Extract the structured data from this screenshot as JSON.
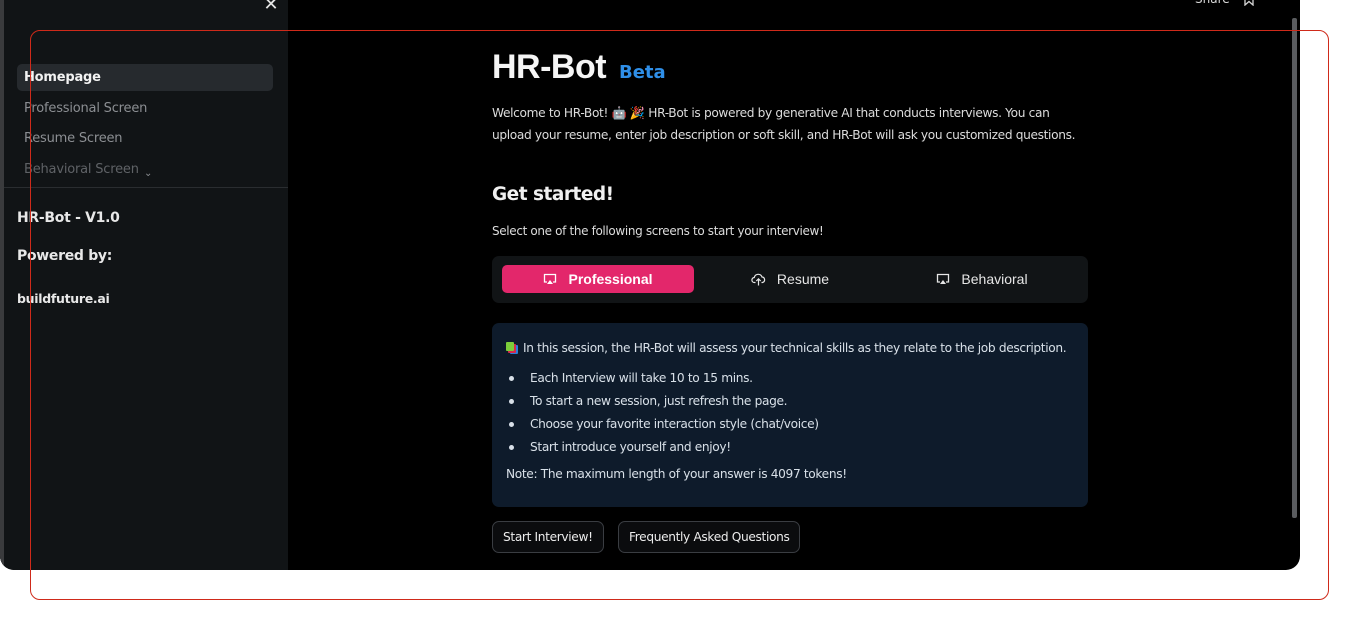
{
  "sidebar": {
    "close_icon": "close-icon",
    "nav_items": [
      {
        "label": "Homepage",
        "active": true
      },
      {
        "label": "Professional Screen",
        "active": false
      },
      {
        "label": "Resume Screen",
        "active": false
      },
      {
        "label": "Behavioral Screen",
        "active": false
      }
    ],
    "expand_icon": "chevron-down-icon",
    "version": "HR-Bot - V1.0",
    "powered_by_label": "Powered by:",
    "powered_by_link": "buildfuture.ai"
  },
  "topbar": {
    "share_label": "Share",
    "star_icon": "star-icon"
  },
  "main": {
    "title": "HR-Bot",
    "badge": "Beta",
    "intro_part1": "Welcome to HR-Bot! ",
    "intro_emojis": "🤖 🎉",
    "intro_part2": " HR-Bot is powered by generative AI that conducts interviews. You can upload your resume, enter job description or soft skill, and HR-Bot will ask you customized questions.",
    "get_started_heading": "Get started!",
    "get_started_sub": "Select one of the following screens to start your interview!",
    "tabs": [
      {
        "label": "Professional",
        "icon": "screen-cast-icon",
        "active": true
      },
      {
        "label": "Resume",
        "icon": "cloud-upload-icon",
        "active": false
      },
      {
        "label": "Behavioral",
        "icon": "screen-cast-icon",
        "active": false
      }
    ],
    "info": {
      "lead": "In this session, the HR-Bot will assess your technical skills as they relate to the job description.",
      "lead_icon": "books-icon",
      "bullets": [
        "Each Interview will take 10 to 15 mins.",
        "To start a new session, just refresh the page.",
        "Choose your favorite interaction style (chat/voice)",
        "Start introduce yourself and enjoy!"
      ],
      "note": "Note: The maximum length of your answer is 4097 tokens!"
    },
    "buttons": {
      "start": "Start Interview!",
      "faq": "Frequently Asked Questions"
    }
  },
  "colors": {
    "accent": "#e3276b",
    "badge": "#2f8fe8",
    "info_bg": "#0e1b2b",
    "sidebar_bg": "#111416",
    "annotation": "#cf2a1a"
  }
}
